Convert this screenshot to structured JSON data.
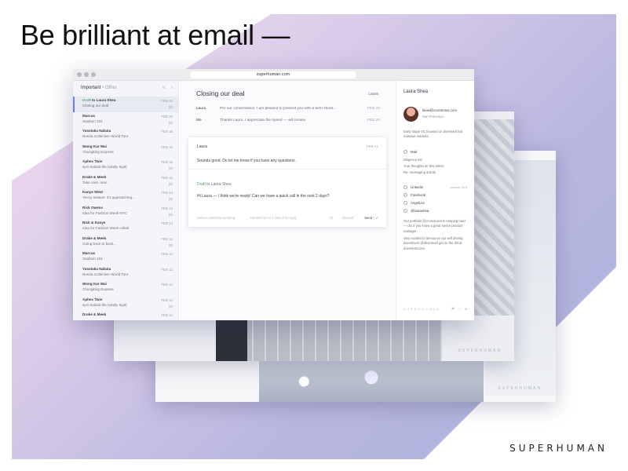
{
  "headline": "Be brilliant at email —",
  "brand": "SUPERHUMAN",
  "back_window_label": "SUPERHUMAN",
  "browser": {
    "url": "superhuman.com"
  },
  "list": {
    "header_active": "Important",
    "header_sep": "•",
    "header_other": "Other",
    "items": [
      {
        "draft": "Draft",
        "from": "to Laura Shea",
        "subject": "Closing our deal",
        "date": "FEB 20",
        "count": "(8)",
        "selected": true
      },
      {
        "from": "Marcus",
        "subject": "Stadium 101",
        "date": "FEB 20",
        "count": "(8)"
      },
      {
        "from": "Yasutaka Nakata",
        "subject": "Nenda Collection World Tour",
        "date": "FEB 18",
        "count": ""
      },
      {
        "from": "Wong Kar Wai",
        "subject": "Chungking Express",
        "date": "FEB 15",
        "count": ""
      },
      {
        "from": "Aphex Twin",
        "subject": "syro leaked file (totally legit)",
        "date": "FEB 15",
        "count": "(8)"
      },
      {
        "from": "Drake & Meek",
        "subject": "Take care, man",
        "date": "FEB 15",
        "count": "(8)"
      },
      {
        "from": "Kanye West",
        "subject": "Yeezy season: it's approaching...",
        "date": "FEB 13",
        "count": "(8)"
      },
      {
        "from": "Rick Owens",
        "subject": "Idea for Fashion Week NYC",
        "date": "FEB 13",
        "count": "(8)"
      },
      {
        "from": "Rick & Kanye",
        "subject": "Idea for Fashion Week collab",
        "date": "FEB 13",
        "count": ""
      },
      {
        "from": "Drake & Meek",
        "subject": "Going back to back...",
        "date": "FEB 12",
        "count": "(8)"
      },
      {
        "from": "Marcus",
        "subject": "Stadium 101",
        "date": "FEB 12",
        "count": ""
      },
      {
        "from": "Yasutaka Nakata",
        "subject": "Nenda Collection World Tour",
        "date": "FEB 12",
        "count": ""
      },
      {
        "from": "Wong Kar Wai",
        "subject": "Chungking Express",
        "date": "FEB 12",
        "count": ""
      },
      {
        "from": "Aphex Twin",
        "subject": "syro leaked file (totally legit)",
        "date": "FEB 12",
        "count": "(8)"
      },
      {
        "from": "Drake & Meek",
        "subject": "",
        "date": "FEB 12",
        "count": ""
      }
    ]
  },
  "thread": {
    "title": "Closing our deal",
    "participant": "Laura",
    "messages": [
      {
        "sender": "Laura",
        "snippet": "Per our conversation, I am pleased to present you with a term sheet...",
        "date": "FEB 20"
      },
      {
        "sender": "Me",
        "snippet": "Thanks Laura, I appreciate the speed — will review.",
        "date": "FEB 20"
      }
    ],
    "open": {
      "sender": "Laura",
      "date": "FEB 21",
      "body": "Sounds good.  Do let me know if you have any questions.",
      "draft_label": "Draft",
      "draft_to": "to Laura Shea",
      "draft_body": "Hi Laura — I think we're ready! Can we have a quick call in the next 2 days?",
      "deliver": "Deliver tomorrow morning",
      "remind": "Remind me in 3 days if no reply",
      "attach": "Clt",
      "discard": "Discard",
      "send": "Send ↑ ✓"
    }
  },
  "contact": {
    "name": "Laura Shea",
    "email": "laura@ccventures.com",
    "location": "San Francisco",
    "bio": "Early stage VC focused on dominant but massive markets.",
    "mail_label": "Mail",
    "mail_items": [
      "Diligence list",
      "Your thoughts on this article",
      "Re: messaging & bots"
    ],
    "socials": [
      {
        "name": "LinkedIn",
        "extra": "connect XXX"
      },
      {
        "name": "Facebook",
        "extra": ""
      },
      {
        "name": "AngelList",
        "extra": ""
      },
      {
        "name": "@laurashea",
        "extra": ""
      }
    ],
    "tweets": [
      "Our portfolio @ccventures is ramping hard — dm if you know a great senior product manager",
      "Very excited to announce our self driving investment @driventool get on the list at driverless.com"
    ],
    "footer": "SUPERHUMAN"
  }
}
